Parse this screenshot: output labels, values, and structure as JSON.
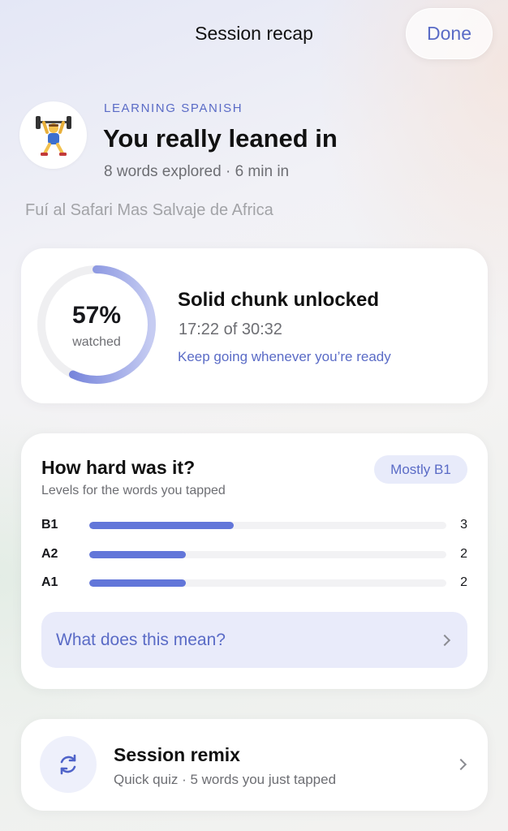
{
  "header": {
    "title": "Session recap",
    "done_label": "Done"
  },
  "hero": {
    "avatar_icon": "weightlifter-emoji",
    "eyebrow": "LEARNING SPANISH",
    "title": "You really leaned in",
    "subtitle": "8 words explored · 6 min in",
    "video_title": "Fuí al Safari Mas Salvaje de Africa"
  },
  "progress": {
    "percent_text": "57%",
    "percent_value": 0.57,
    "ring_label": "watched",
    "title": "Solid chunk unlocked",
    "time": "17:22 of 30:32",
    "note": "Keep going whenever you’re ready"
  },
  "levels": {
    "title": "How hard was it?",
    "subtitle": "Levels for the words you tapped",
    "badge": "Mostly B1",
    "max_count": 3,
    "rows": [
      {
        "level": "B1",
        "count": "3",
        "value": 3
      },
      {
        "level": "A2",
        "count": "2",
        "value": 2
      },
      {
        "level": "A1",
        "count": "2",
        "value": 2
      }
    ],
    "meaning_label": "What does this mean?"
  },
  "remix": {
    "icon": "refresh-icon",
    "title": "Session remix",
    "subtitle": "Quick quiz · 5 words you just tapped"
  },
  "colors": {
    "accent": "#5a6bc6",
    "bar_fill": "#6276d9",
    "badge_bg": "#e8ebfa"
  }
}
